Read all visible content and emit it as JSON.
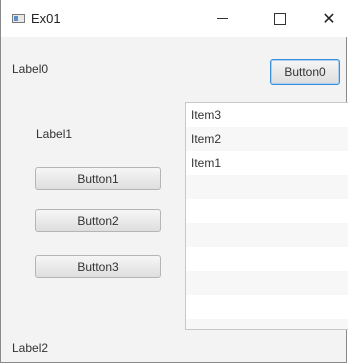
{
  "window": {
    "title": "Ex01",
    "minimize_glyph": "",
    "maximize_glyph": "",
    "close_glyph": "✕"
  },
  "labels": {
    "label0": "Label0",
    "label1": "Label1",
    "label2": "Label2"
  },
  "buttons": {
    "button0": "Button0",
    "button1": "Button1",
    "button2": "Button2",
    "button3": "Button3"
  },
  "list": {
    "items": [
      "Item3",
      "Item2",
      "Item1",
      "",
      "",
      "",
      "",
      "",
      "",
      ""
    ]
  }
}
